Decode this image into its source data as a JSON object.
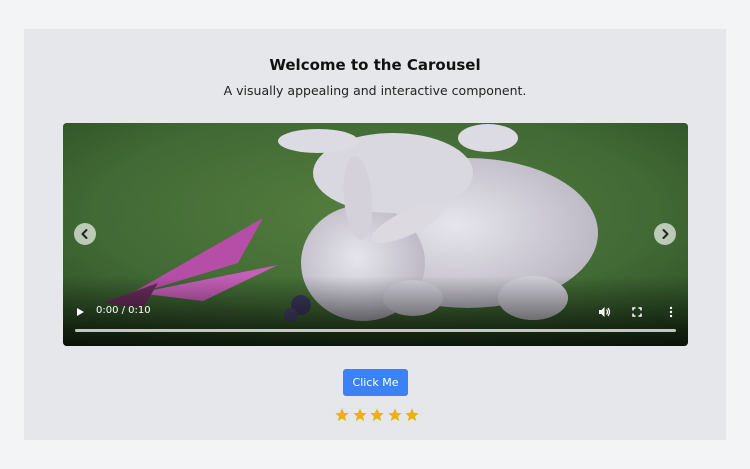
{
  "header": {
    "title": "Welcome to the Carousel",
    "subtitle": "A visually appealing and interactive component."
  },
  "video": {
    "time_display": "0:00 / 0:10",
    "progress": 0
  },
  "cta": {
    "label": "Click Me"
  },
  "rating": {
    "value": 5,
    "max": 5,
    "color": "#eab308"
  },
  "colors": {
    "accent": "#3b82f6",
    "card_bg": "#e5e7eb",
    "page_bg": "#f3f4f6"
  }
}
